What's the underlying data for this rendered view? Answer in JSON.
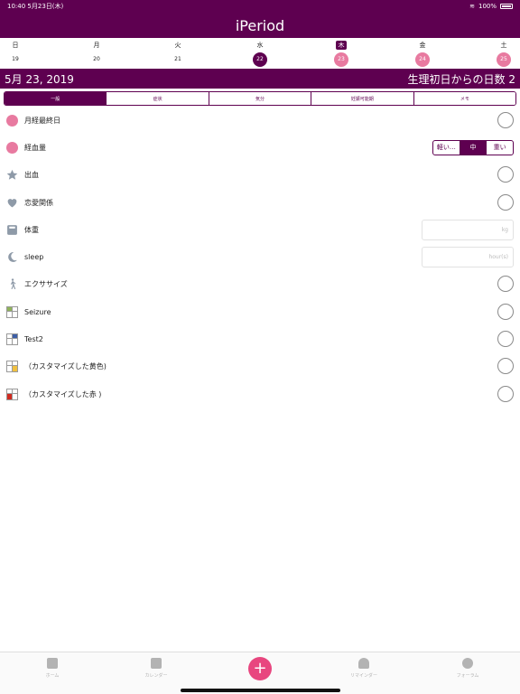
{
  "status": {
    "time": "10:40",
    "date": "5月23日(木)",
    "battery": "100%"
  },
  "app": {
    "title": "iPeriod"
  },
  "week": [
    {
      "dow": "日",
      "date": "19"
    },
    {
      "dow": "月",
      "date": "20"
    },
    {
      "dow": "火",
      "date": "21"
    },
    {
      "dow": "水",
      "date": "22"
    },
    {
      "dow": "木",
      "date": "23"
    },
    {
      "dow": "金",
      "date": "24"
    },
    {
      "dow": "土",
      "date": "25"
    }
  ],
  "datebar": {
    "date": "5月 23, 2019",
    "cycle_day": "生理初日からの日数 2"
  },
  "segments": [
    "一般",
    "症状",
    "気分",
    "妊娠可能期",
    "メモ"
  ],
  "rows": [
    {
      "label": "月経最終日"
    },
    {
      "label": "経血量"
    },
    {
      "label": "出血"
    },
    {
      "label": "恋愛関係"
    },
    {
      "label": "体重",
      "unit": "kg"
    },
    {
      "label": "sleep",
      "unit": "hour(s)"
    },
    {
      "label": "エクササイズ"
    },
    {
      "label": "Seizure"
    },
    {
      "label": "Test2"
    },
    {
      "label": "（カスタマイズした黄色)"
    },
    {
      "label": "（カスタマイズした赤 )"
    }
  ],
  "flow_options": [
    "軽い…",
    "中",
    "重い"
  ],
  "tabs": [
    "ホーム",
    "カレンダー",
    "+",
    "リマインダー",
    "フォーラム"
  ],
  "colors": {
    "accent": "#5e0050",
    "period": "#e87aa0",
    "add": "#e8467f"
  }
}
